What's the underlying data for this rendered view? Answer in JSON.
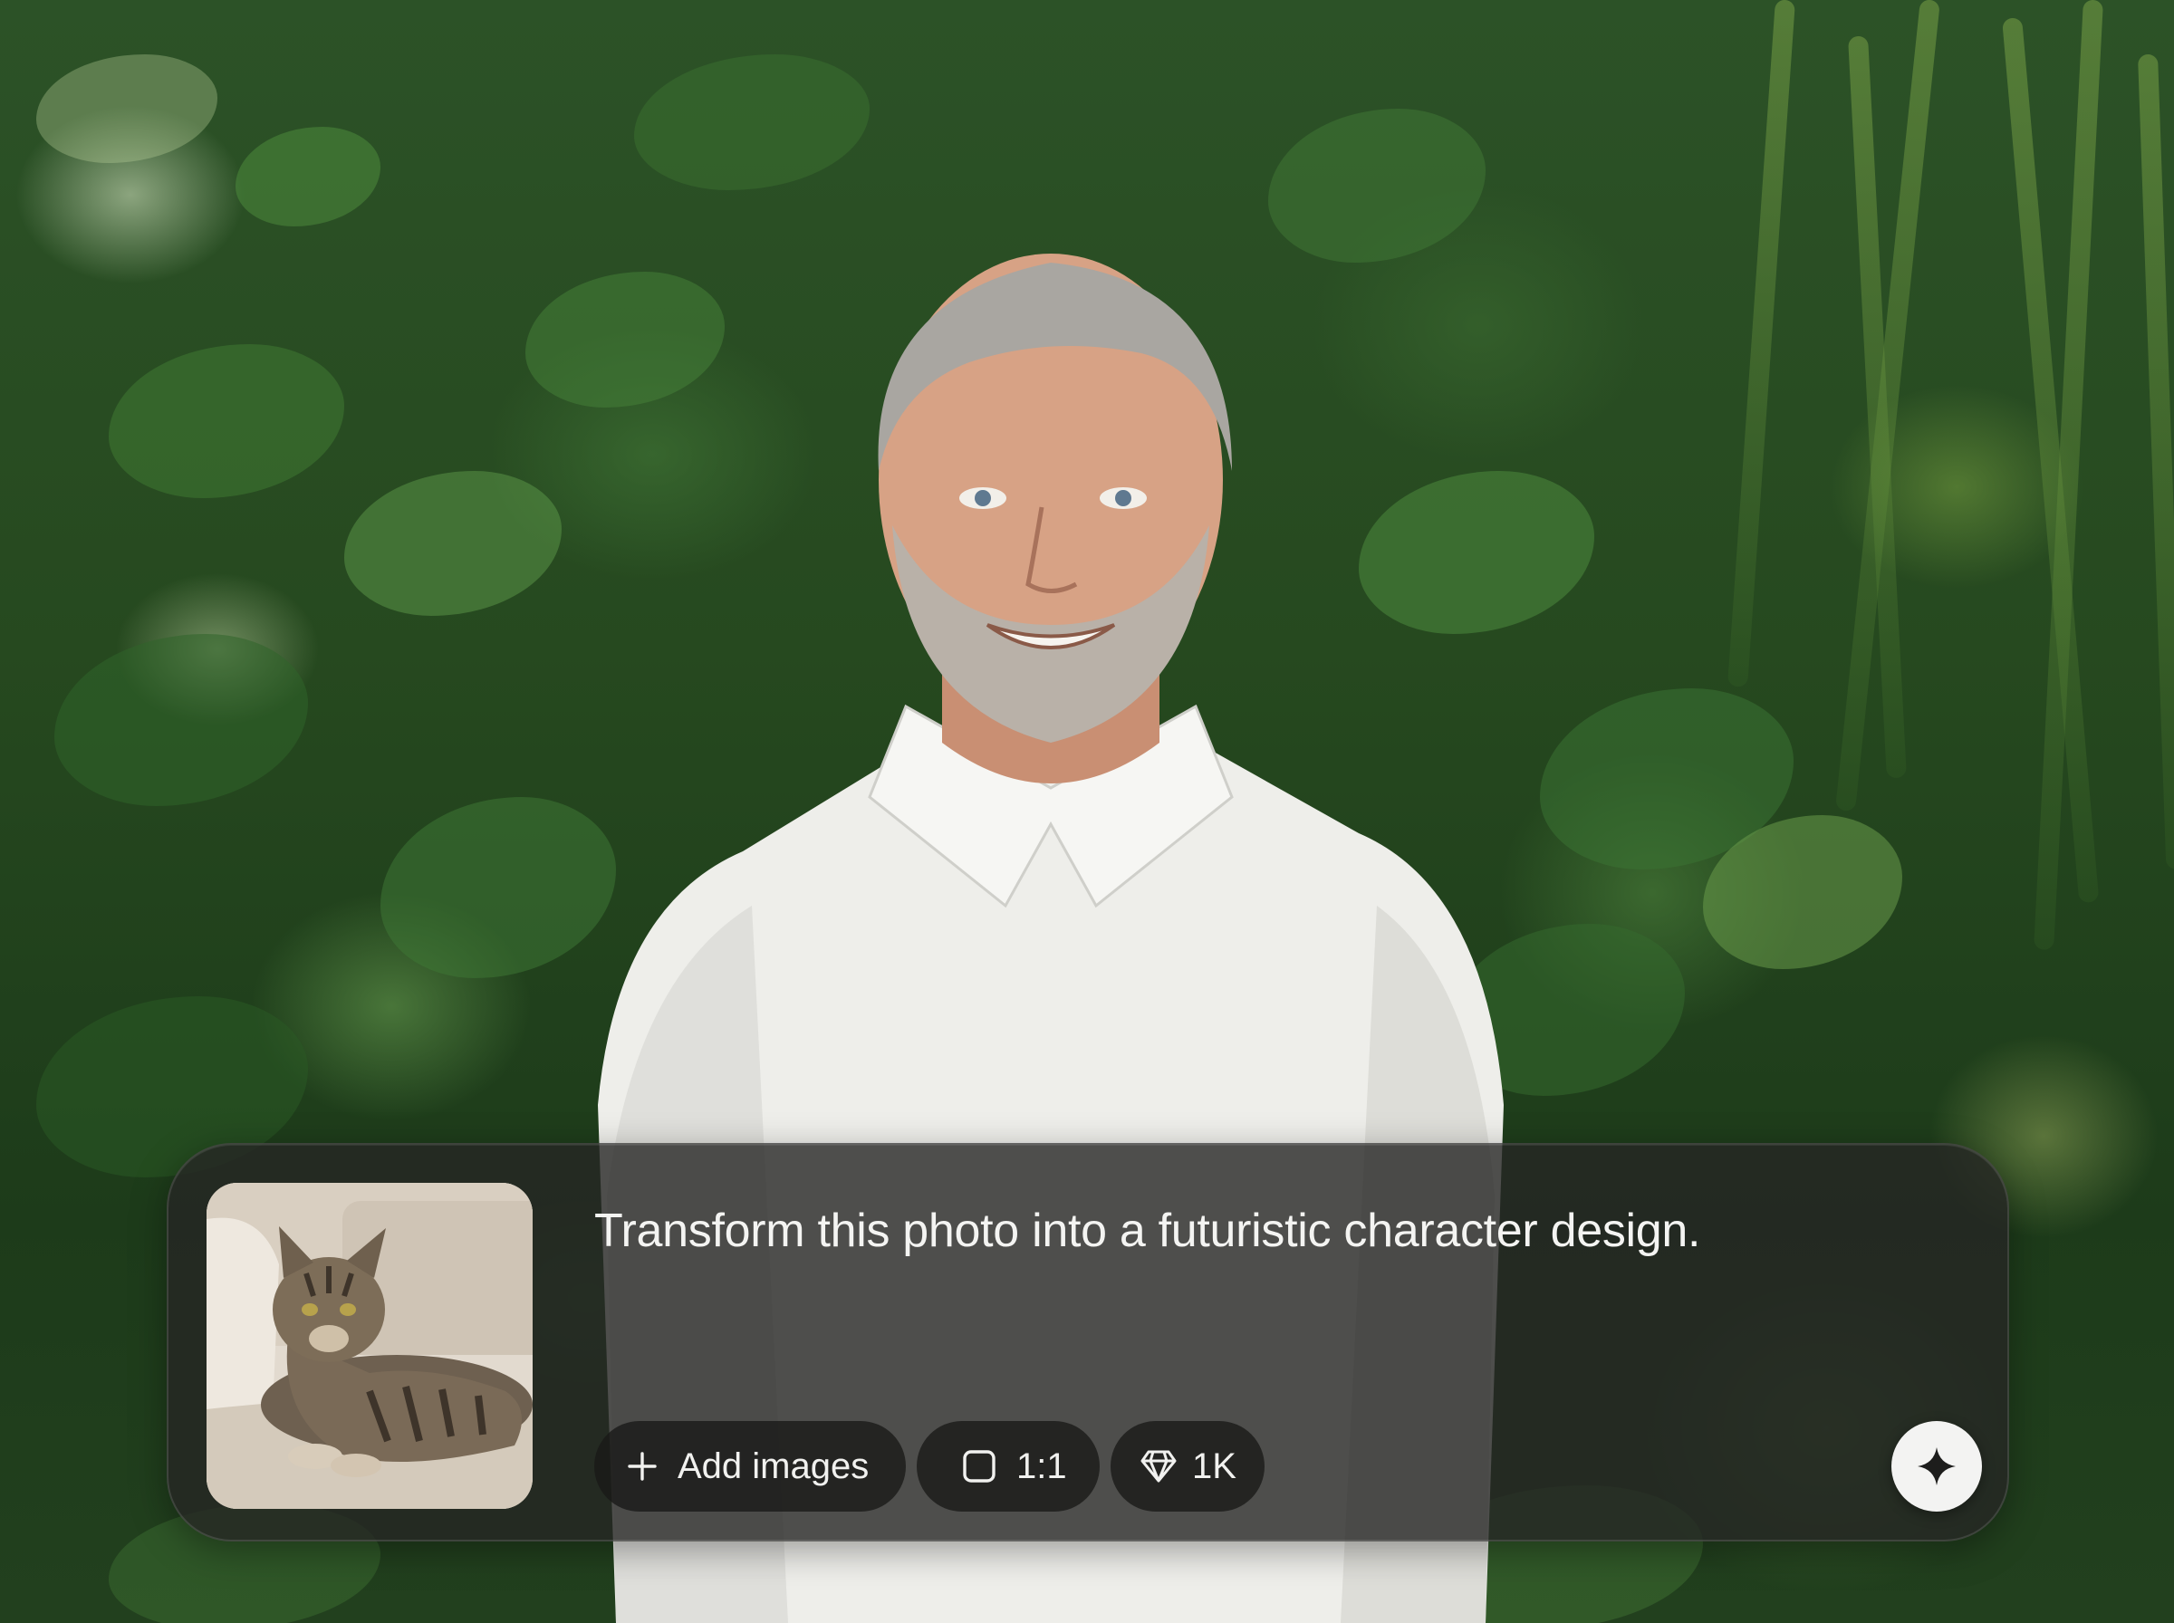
{
  "prompt": {
    "text": "Transform this photo into a futuristic character design."
  },
  "toolbar": {
    "add_images_label": "Add images",
    "aspect_ratio_label": "1:1",
    "resolution_label": "1K"
  },
  "icons": {
    "add": "plus-icon",
    "aspect_ratio": "square-icon",
    "resolution": "diamond-icon",
    "generate": "sparkle-icon"
  },
  "colors": {
    "panel_background": "#262624",
    "pill_background": "#181817",
    "text": "#f4f4f2",
    "generate_button": "#f3f3f2"
  }
}
